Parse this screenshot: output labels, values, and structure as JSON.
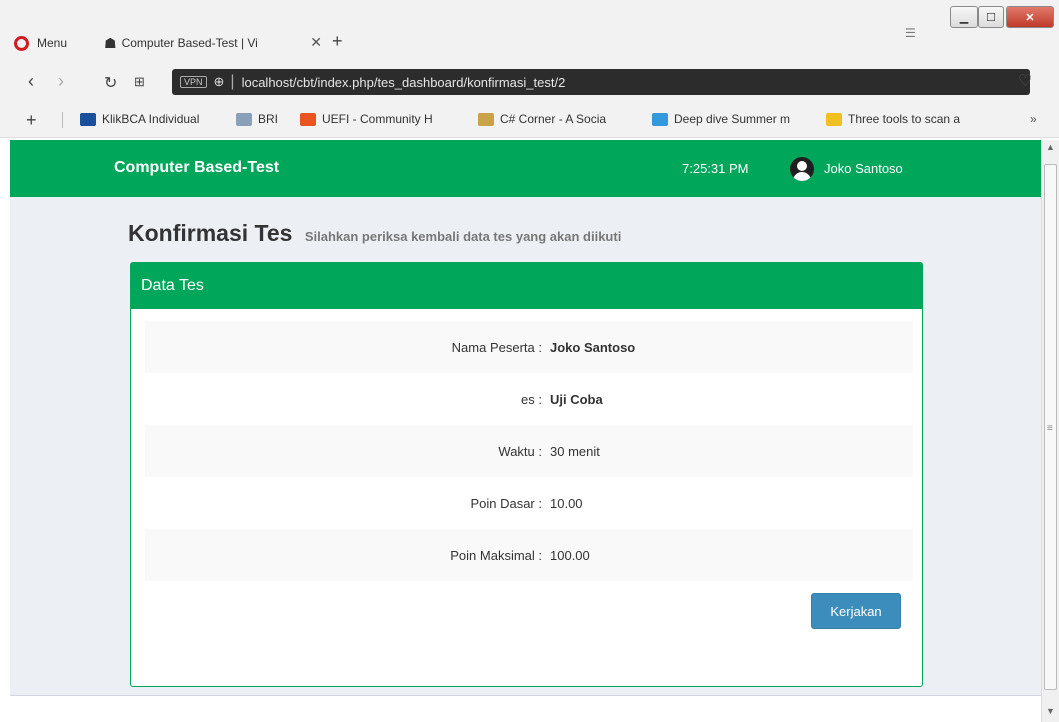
{
  "browser": {
    "menu_label": "Menu",
    "tab_title": "Computer Based-Test | Vi",
    "tab_close": "✕",
    "new_tab": "+",
    "url": "localhost/cbt/index.php/tes_dashboard/konfirmasi_test/2",
    "vpn_label": "VPN",
    "bookmarks": [
      {
        "label": "KlikBCA Individual",
        "color": "#1a4f9c"
      },
      {
        "label": "BRI",
        "color": "#8aa0b8"
      },
      {
        "label": "UEFI - Community H",
        "color": "#e95420"
      },
      {
        "label": "C# Corner - A Socia",
        "color": "#c9a34a"
      },
      {
        "label": "Deep dive Summer m",
        "color": "#3399dd"
      },
      {
        "label": "Three tools to scan a",
        "color": "#f0c020"
      }
    ]
  },
  "app": {
    "brand": "Computer Based-Test",
    "clock": "7:25:31 PM",
    "user_name": "Joko Santoso"
  },
  "page": {
    "title": "Konfirmasi Tes",
    "subtitle": "Silahkan periksa kembali data tes yang akan diikuti"
  },
  "box": {
    "title": "Data Tes",
    "rows": [
      {
        "label": "Nama Peserta :",
        "value": "Joko Santoso"
      },
      {
        "label": "es :",
        "value": "Uji Coba"
      },
      {
        "label": "Waktu :",
        "value": "30 menit"
      },
      {
        "label": "Poin Dasar :",
        "value": "10.00"
      },
      {
        "label": "Poin Maksimal :",
        "value": "100.00"
      }
    ],
    "button": "Kerjakan"
  },
  "colors": {
    "header_green": "#00a65a",
    "button_blue": "#3c8dbc",
    "page_bg": "#ecf0f5"
  }
}
